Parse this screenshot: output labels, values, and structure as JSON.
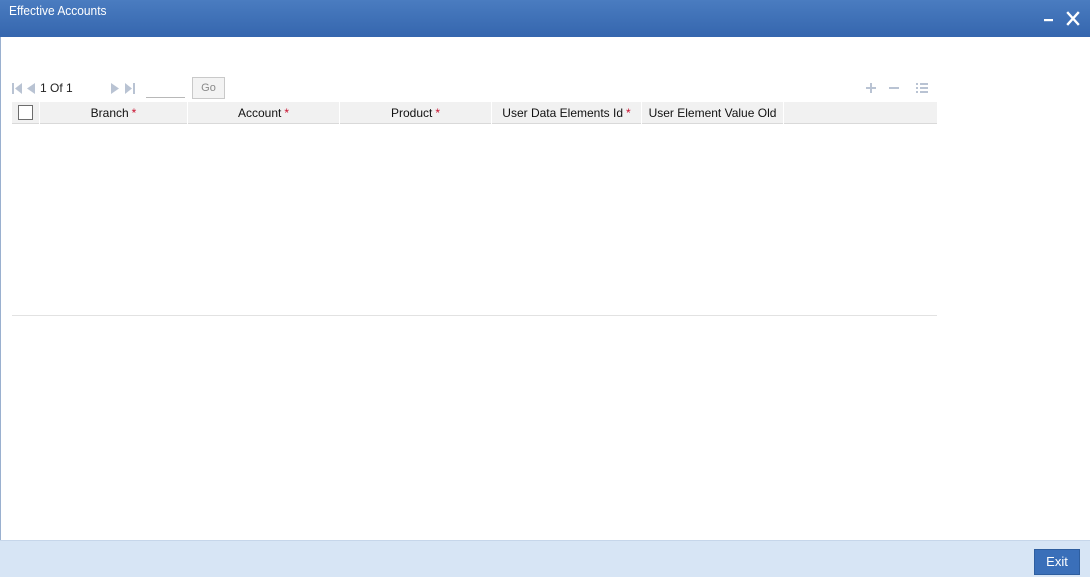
{
  "window": {
    "title": "Effective Accounts",
    "minimize_icon": "minimize-icon",
    "close_icon": "close-icon"
  },
  "pagination": {
    "page_label": "1 Of 1",
    "page_input_value": "",
    "go_label": "Go",
    "icons": [
      "first-page-icon",
      "previous-page-icon",
      "next-page-icon",
      "last-page-icon"
    ]
  },
  "grid_tools": {
    "add_icon": "add-row-icon",
    "remove_icon": "delete-row-icon",
    "view_icon": "single-record-view-icon",
    "icon_color": "#b9c3d3"
  },
  "table": {
    "columns": [
      {
        "label": "Branch",
        "required": "*"
      },
      {
        "label": "Account",
        "required": "*"
      },
      {
        "label": "Product",
        "required": "*"
      },
      {
        "label": "User Data Elements Id",
        "required": "*"
      },
      {
        "label": "User Element Value Old",
        "required": ""
      }
    ],
    "rows": []
  },
  "footer": {
    "exit_label": "Exit"
  },
  "colors": {
    "titlebar": "#3b6fb6",
    "footer": "#d7e5f5",
    "required_mark": "#c8102e",
    "exit_button": "#3a6fb9"
  }
}
